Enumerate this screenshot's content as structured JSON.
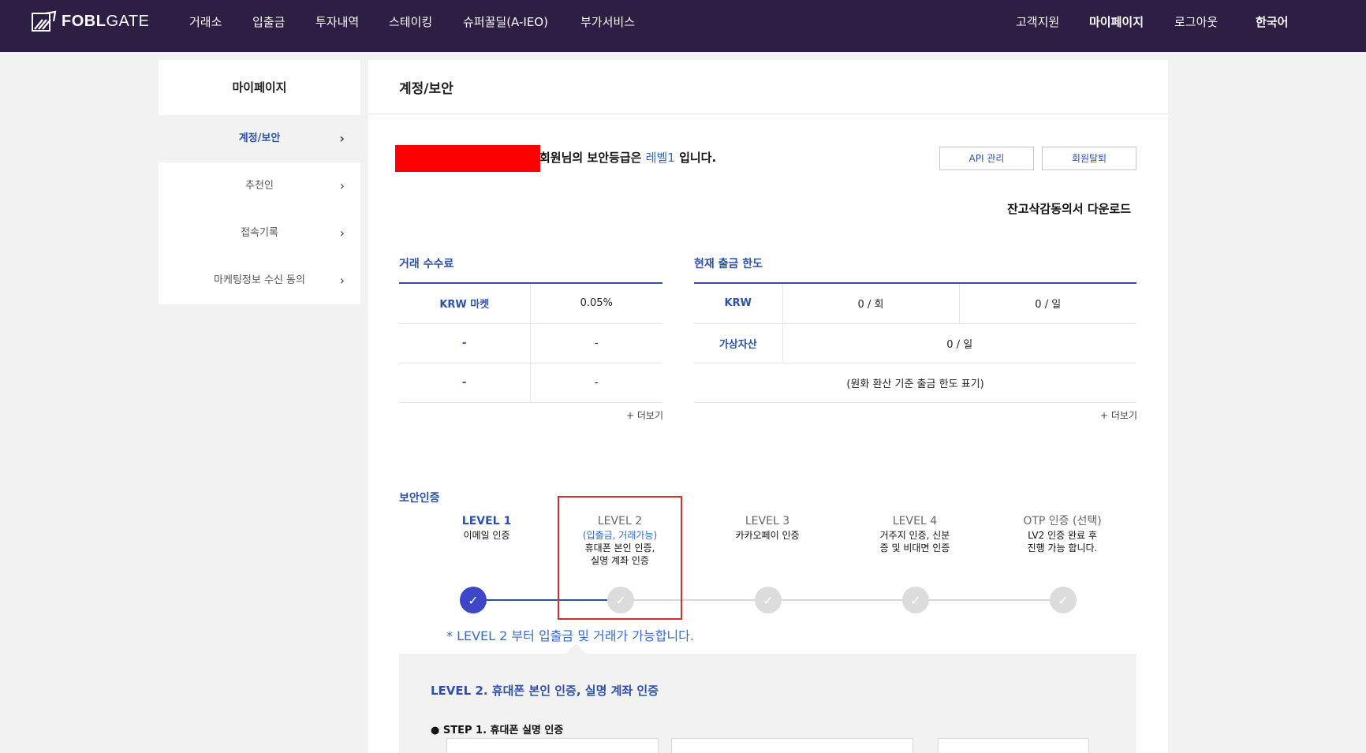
{
  "nav": {
    "logo_bold": "FOBL",
    "logo_light": "GATE",
    "items": [
      "거래소",
      "입출금",
      "투자내역",
      "스테이킹",
      "슈퍼꿀딜(A-IEO)",
      "부가서비스"
    ],
    "right": [
      "고객지원",
      "마이페이지",
      "로그아웃",
      "한국어"
    ]
  },
  "sidebar": {
    "title": "마이페이지",
    "items": [
      "계정/보안",
      "추천인",
      "접속기록",
      "마케팅정보 수신 동의"
    ]
  },
  "main": {
    "title": "계정/보안",
    "security_prefix": "회원님의 보안등급은",
    "security_level": "레벨1",
    "security_suffix": "입니다.",
    "api_button": "API 관리",
    "withdraw_button": "회원탈퇴",
    "download_link": "잔고삭감동의서 다운로드"
  },
  "fee": {
    "title": "거래 수수료",
    "rows": [
      [
        "KRW 마켓",
        "0.05%"
      ],
      [
        "-",
        "-"
      ],
      [
        "-",
        "-"
      ]
    ],
    "more": "+ 더보기"
  },
  "limit": {
    "title": "현재 출금 한도",
    "krw_label": "KRW",
    "krw_per_time": "0 / 회",
    "krw_per_day": "0 / 일",
    "crypto_label": "가상자산",
    "crypto_per_day": "0 / 일",
    "note": "(원화 환산 기준 출금 한도 표기)",
    "more": "+ 더보기"
  },
  "cert": {
    "title": "보안인증",
    "levels": [
      {
        "name": "LEVEL 1",
        "desc1": "이메일 인증",
        "desc2": ""
      },
      {
        "name": "LEVEL 2",
        "blue": "(입출금, 거래가능)",
        "desc1": "휴대폰 본인 인증,",
        "desc2": "실명 계좌 인증"
      },
      {
        "name": "LEVEL 3",
        "desc1": "카카오페이 인증",
        "desc2": ""
      },
      {
        "name": "LEVEL 4",
        "desc1": "거주지 인증, 신분",
        "desc2": "증 및 비대면 인증"
      },
      {
        "name": "OTP 인증 (선택)",
        "desc1": "LV2 인증 완료 후",
        "desc2": "진행 가능 합니다."
      }
    ],
    "check_mark": "✓",
    "notice": "* LEVEL 2 부터 입출금 및 거래가 가능합니다.",
    "detail_title": "LEVEL 2. 휴대폰 본인 인증, 실명 계좌 인증",
    "step1": "● STEP 1. 휴대폰 실명 인증"
  },
  "colors": {
    "nav_bg": "#2d1f44",
    "accent_blue": "#2e51a7",
    "link_blue": "#3a6ac9",
    "step_done": "#3d46c7",
    "redaction": "#ff0000",
    "highlight_box": "#d32f2f"
  }
}
